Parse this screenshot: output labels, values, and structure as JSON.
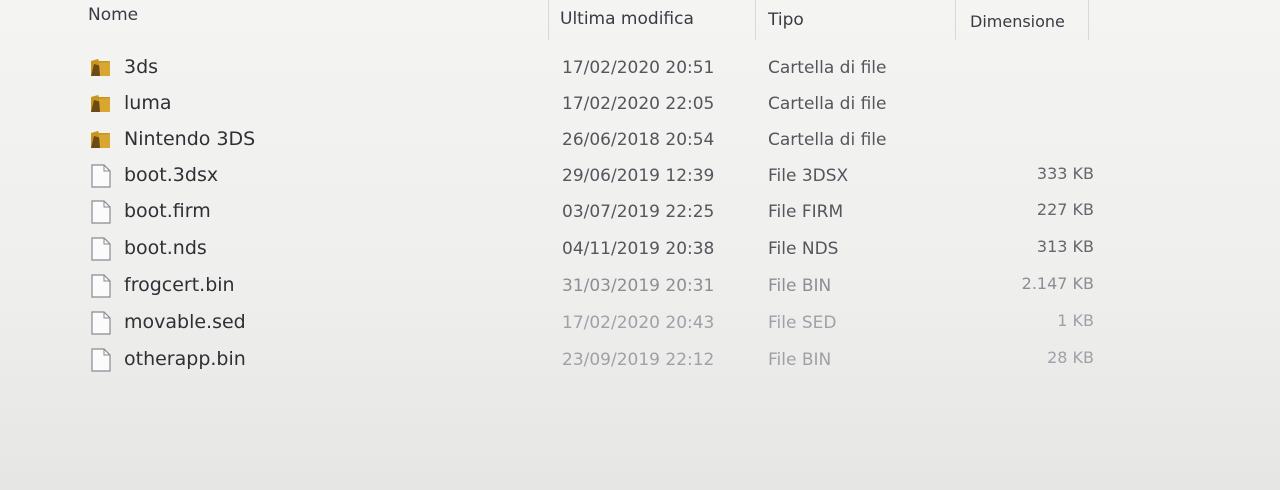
{
  "columns": {
    "name": "Nome",
    "modified": "Ultima modifica",
    "type": "Tipo",
    "size": "Dimensione"
  },
  "items": [
    {
      "name": "3ds",
      "modified": "17/02/2020 20:51",
      "type": "Cartella di file",
      "size": "",
      "icon": "folder-icon"
    },
    {
      "name": "luma",
      "modified": "17/02/2020 22:05",
      "type": "Cartella di file",
      "size": "",
      "icon": "folder-icon"
    },
    {
      "name": "Nintendo 3DS",
      "modified": "26/06/2018 20:54",
      "type": "Cartella di file",
      "size": "",
      "icon": "folder-icon"
    },
    {
      "name": "boot.3dsx",
      "modified": "29/06/2019 12:39",
      "type": "File 3DSX",
      "size": "333 KB",
      "icon": "file-icon"
    },
    {
      "name": "boot.firm",
      "modified": "03/07/2019 22:25",
      "type": "File FIRM",
      "size": "227 KB",
      "icon": "file-icon"
    },
    {
      "name": "boot.nds",
      "modified": "04/11/2019 20:38",
      "type": "File NDS",
      "size": "313 KB",
      "icon": "file-icon"
    },
    {
      "name": "frogcert.bin",
      "modified": "31/03/2019 20:31",
      "type": "File BIN",
      "size": "2.147 KB",
      "icon": "file-icon"
    },
    {
      "name": "movable.sed",
      "modified": "17/02/2020 20:43",
      "type": "File SED",
      "size": "1 KB",
      "icon": "file-icon"
    },
    {
      "name": "otherapp.bin",
      "modified": "23/09/2019 22:12",
      "type": "File BIN",
      "size": "28 KB",
      "icon": "file-icon"
    }
  ],
  "colors": {
    "folder_body": "#c8961e",
    "folder_dark": "#6b4a16",
    "file_outline": "#8a8a92",
    "file_fill": "#fbfbfb"
  }
}
